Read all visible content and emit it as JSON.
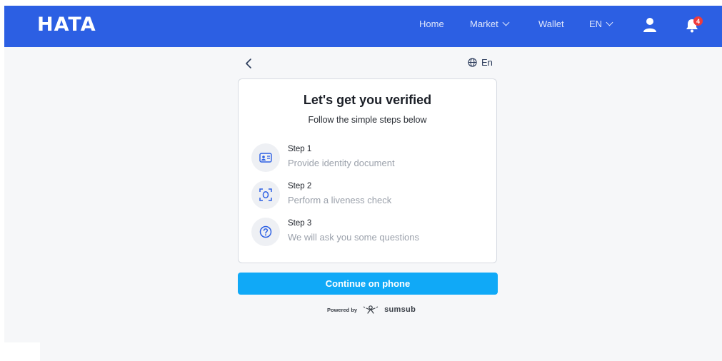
{
  "header": {
    "logo": "HATA",
    "nav": {
      "home": "Home",
      "market": "Market",
      "wallet": "Wallet",
      "language": "EN"
    },
    "notifications_count": "4",
    "colors": {
      "bar": "#2c5fe3",
      "badge": "#ef3b3b"
    }
  },
  "verify": {
    "back_icon": "chevron-left-icon",
    "language": "En",
    "title": "Let's get you verified",
    "subtitle": "Follow the simple steps below",
    "steps": [
      {
        "title": "Step 1",
        "description": "Provide identity document",
        "icon": "id-card-icon"
      },
      {
        "title": "Step 2",
        "description": "Perform a liveness check",
        "icon": "face-scan-icon"
      },
      {
        "title": "Step 3",
        "description": "We will ask you some questions",
        "icon": "question-icon"
      }
    ],
    "cta_label": "Continue on phone",
    "cta_color": "#10a9f7",
    "powered_by": "Powered by",
    "provider": "sumsub"
  }
}
